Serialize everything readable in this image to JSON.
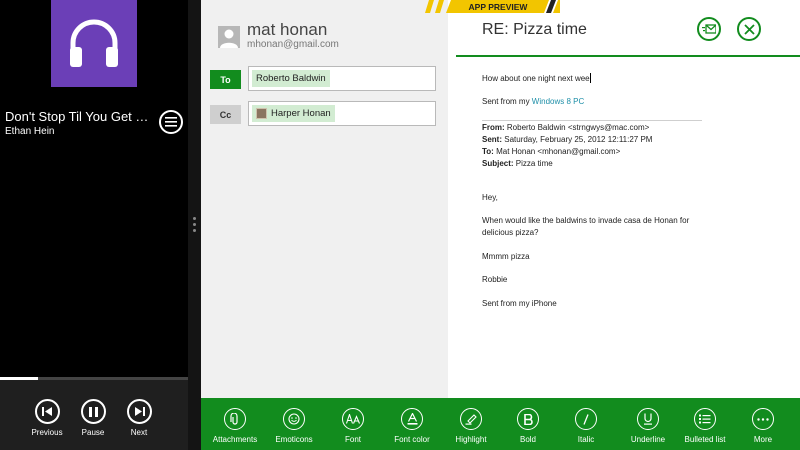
{
  "music": {
    "track_title": "Don't Stop Til You Get En…",
    "artist": "Ethan Hein",
    "progress": 0.2,
    "controls": [
      {
        "label": "Previous",
        "icon": "previous-icon"
      },
      {
        "label": "Pause",
        "icon": "pause-icon"
      },
      {
        "label": "Next",
        "icon": "next-icon"
      }
    ]
  },
  "compose": {
    "sender_name": "mat honan",
    "sender_email": "mhonan@gmail.com",
    "to_label": "To",
    "cc_label": "Cc",
    "to_recipient": "Roberto Baldwin",
    "cc_recipient": "Harper Honan",
    "subject": "RE: Pizza time",
    "ribbon_text": "APP PREVIEW",
    "accent_color": "#128c1e"
  },
  "message": {
    "typed": "How about one night next wee",
    "sig_prefix": "Sent from my ",
    "sig_link": "Windows 8 PC",
    "quote": {
      "from_label": "From:",
      "from": "Roberto Baldwin <strngwys@mac.com>",
      "sent_label": "Sent:",
      "sent": "Saturday, February 25, 2012 12:11:27 PM",
      "to_label": "To:",
      "to": "Mat Honan <mhonan@gmail.com>",
      "subject_label": "Subject:",
      "subject": "Pizza time",
      "greeting": "Hey,",
      "line1": "When would like the baldwins to invade casa de Honan for",
      "line2": "delicious pizza?",
      "line3": "Mmmm pizza",
      "name": "Robbie",
      "signature": "Sent from my iPhone"
    }
  },
  "appbar": [
    {
      "label": "Attachments",
      "icon": "paperclip-icon"
    },
    {
      "label": "Emoticons",
      "icon": "smiley-icon"
    },
    {
      "label": "Font",
      "icon": "font-icon"
    },
    {
      "label": "Font color",
      "icon": "font-color-icon"
    },
    {
      "label": "Highlight",
      "icon": "highlight-icon"
    },
    {
      "label": "Bold",
      "icon": "bold-icon"
    },
    {
      "label": "Italic",
      "icon": "italic-icon"
    },
    {
      "label": "Underline",
      "icon": "underline-icon"
    },
    {
      "label": "Bulleted list",
      "icon": "bulleted-list-icon"
    },
    {
      "label": "More",
      "icon": "more-icon"
    }
  ]
}
